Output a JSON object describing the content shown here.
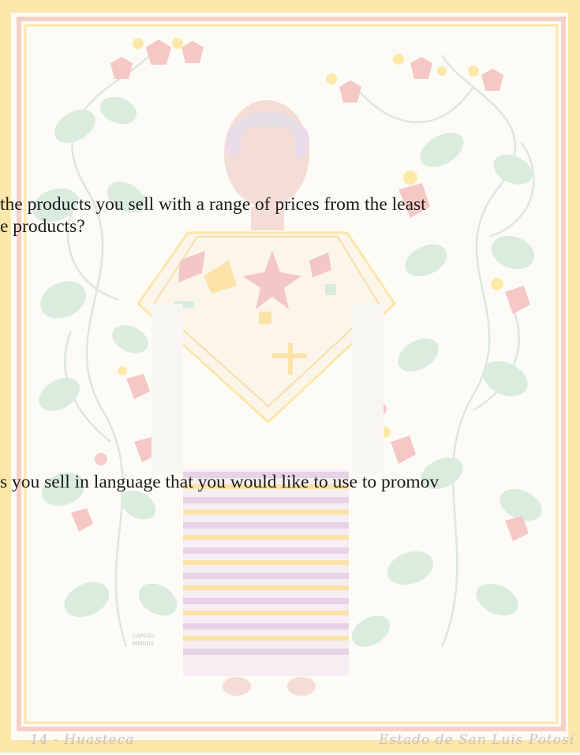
{
  "colors": {
    "page": "#fdfbf6",
    "frame_outer": "#fbe7a9",
    "frame_inner": "#f6cfc7",
    "leaf": "#d9ecdd",
    "flower": "#f6c8c5",
    "petal_yellow": "#fde9a7",
    "text": "#1b1b1b"
  },
  "document": {
    "question1_line1": "the products you sell with a range of prices from the least",
    "question1_line2": "e products?",
    "question2_line1": "s you sell in language that you would like to use to promov"
  },
  "artwork": {
    "signature": "CARLOS MERIDA",
    "caption_left": "14 - Huasteca",
    "caption_right": "Estado de San Luis Potosí"
  }
}
